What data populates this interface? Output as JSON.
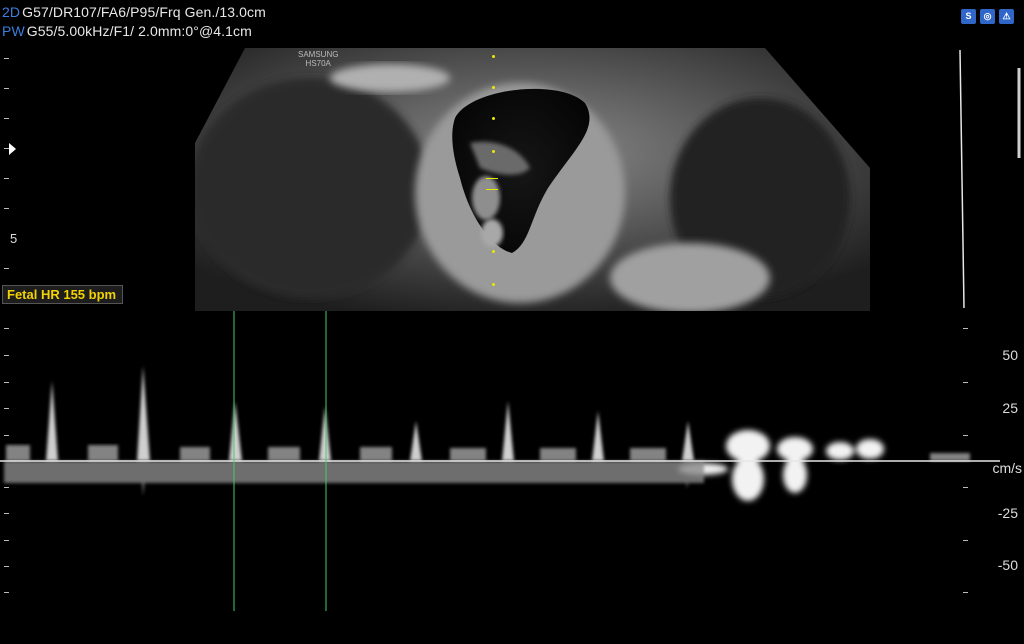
{
  "header": {
    "line1_mode": "2D",
    "line1_params": "G57/DR107/FA6/P95/Frq Gen./13.0cm",
    "line2_mode": "PW",
    "line2_params": "G55/5.00kHz/F1/ 2.0mm:0°@4.1cm"
  },
  "status_icons": [
    {
      "label": "S",
      "icon": "probe-icon"
    },
    {
      "label": "◎",
      "icon": "transducer-icon"
    },
    {
      "label": "⚠",
      "icon": "warning-icon"
    }
  ],
  "device": {
    "brand_line1": "SAMSUNG",
    "brand_line2": "HS70A"
  },
  "depth_scale": {
    "label": "5"
  },
  "measurement": {
    "fetal_hr": "Fetal HR 155  bpm"
  },
  "doppler_scale": {
    "labels": [
      "50",
      "25",
      "-25",
      "-50"
    ],
    "unit": "cm/s"
  },
  "colors": {
    "mode_accent": "#3d7fe0",
    "measurement_text": "#f2d200",
    "caliper_line": "#3fd06a",
    "sample_gate": "#e8e800"
  }
}
